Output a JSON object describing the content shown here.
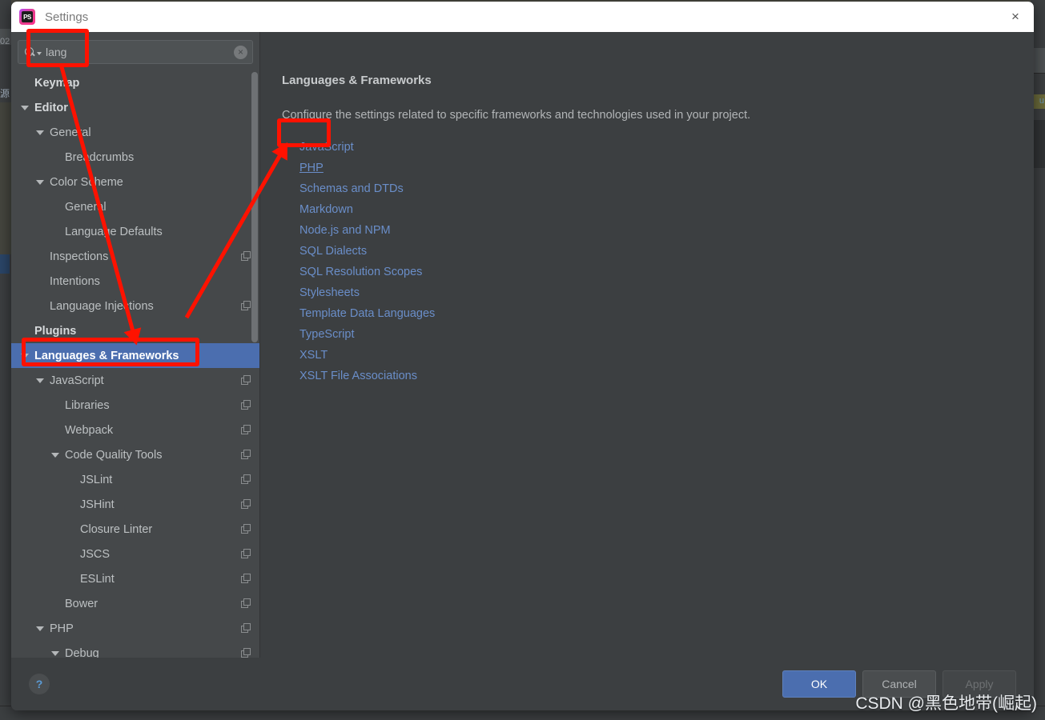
{
  "window": {
    "title": "Settings",
    "app_icon": "phpstorm-logo-icon",
    "close_icon": "×"
  },
  "search": {
    "value": "lang",
    "placeholder": "",
    "search_icon": "search-icon",
    "dropdown_icon": "chevron-down-icon",
    "clear_icon": "×"
  },
  "sidebar": {
    "items": [
      {
        "label": "Keymap",
        "indent": 0,
        "bold": true,
        "twisty": "none",
        "selected": false,
        "scope_icon": false
      },
      {
        "label": "Editor",
        "indent": 0,
        "bold": true,
        "twisty": "open",
        "selected": false,
        "scope_icon": false
      },
      {
        "label": "General",
        "indent": 1,
        "bold": false,
        "twisty": "open",
        "selected": false,
        "scope_icon": false
      },
      {
        "label": "Breadcrumbs",
        "indent": 2,
        "bold": false,
        "twisty": "none",
        "selected": false,
        "scope_icon": false
      },
      {
        "label": "Color Scheme",
        "indent": 1,
        "bold": false,
        "twisty": "open",
        "selected": false,
        "scope_icon": false
      },
      {
        "label": "General",
        "indent": 2,
        "bold": false,
        "twisty": "none",
        "selected": false,
        "scope_icon": false
      },
      {
        "label": "Language Defaults",
        "indent": 2,
        "bold": false,
        "twisty": "none",
        "selected": false,
        "scope_icon": false
      },
      {
        "label": "Inspections",
        "indent": 1,
        "bold": false,
        "twisty": "none",
        "selected": false,
        "scope_icon": true
      },
      {
        "label": "Intentions",
        "indent": 1,
        "bold": false,
        "twisty": "none",
        "selected": false,
        "scope_icon": false
      },
      {
        "label": "Language Injections",
        "indent": 1,
        "bold": false,
        "twisty": "none",
        "selected": false,
        "scope_icon": true
      },
      {
        "label": "Plugins",
        "indent": 0,
        "bold": true,
        "twisty": "none",
        "selected": false,
        "scope_icon": false
      },
      {
        "label": "Languages & Frameworks",
        "indent": 0,
        "bold": true,
        "twisty": "open",
        "selected": true,
        "scope_icon": false
      },
      {
        "label": "JavaScript",
        "indent": 1,
        "bold": false,
        "twisty": "open",
        "selected": false,
        "scope_icon": true
      },
      {
        "label": "Libraries",
        "indent": 2,
        "bold": false,
        "twisty": "none",
        "selected": false,
        "scope_icon": true
      },
      {
        "label": "Webpack",
        "indent": 2,
        "bold": false,
        "twisty": "none",
        "selected": false,
        "scope_icon": true
      },
      {
        "label": "Code Quality Tools",
        "indent": 2,
        "bold": false,
        "twisty": "open",
        "selected": false,
        "scope_icon": true
      },
      {
        "label": "JSLint",
        "indent": 3,
        "bold": false,
        "twisty": "none",
        "selected": false,
        "scope_icon": true
      },
      {
        "label": "JSHint",
        "indent": 3,
        "bold": false,
        "twisty": "none",
        "selected": false,
        "scope_icon": true
      },
      {
        "label": "Closure Linter",
        "indent": 3,
        "bold": false,
        "twisty": "none",
        "selected": false,
        "scope_icon": true
      },
      {
        "label": "JSCS",
        "indent": 3,
        "bold": false,
        "twisty": "none",
        "selected": false,
        "scope_icon": true
      },
      {
        "label": "ESLint",
        "indent": 3,
        "bold": false,
        "twisty": "none",
        "selected": false,
        "scope_icon": true
      },
      {
        "label": "Bower",
        "indent": 2,
        "bold": false,
        "twisty": "none",
        "selected": false,
        "scope_icon": true
      },
      {
        "label": "PHP",
        "indent": 1,
        "bold": false,
        "twisty": "open",
        "selected": false,
        "scope_icon": true
      },
      {
        "label": "Debug",
        "indent": 2,
        "bold": false,
        "twisty": "open",
        "selected": false,
        "scope_icon": true
      }
    ]
  },
  "main": {
    "heading": "Languages & Frameworks",
    "description": "Configure the settings related to specific frameworks and technologies used in your project.",
    "links": [
      {
        "label": "JavaScript",
        "hovered": false
      },
      {
        "label": "PHP",
        "hovered": true
      },
      {
        "label": "Schemas and DTDs",
        "hovered": false
      },
      {
        "label": "Markdown",
        "hovered": false
      },
      {
        "label": "Node.js and NPM",
        "hovered": false
      },
      {
        "label": "SQL Dialects",
        "hovered": false
      },
      {
        "label": "SQL Resolution Scopes",
        "hovered": false
      },
      {
        "label": "Stylesheets",
        "hovered": false
      },
      {
        "label": "Template Data Languages",
        "hovered": false
      },
      {
        "label": "TypeScript",
        "hovered": false
      },
      {
        "label": "XSLT",
        "hovered": false
      },
      {
        "label": "XSLT File Associations",
        "hovered": false
      }
    ]
  },
  "footer": {
    "help_icon": "?",
    "ok_label": "OK",
    "cancel_label": "Cancel",
    "apply_label": "Apply"
  },
  "annotations": {
    "highlight_color": "#ff1200",
    "boxes": [
      "search-field",
      "sidebar-languages-frameworks",
      "link-php"
    ],
    "arrows": [
      "search-to-sidebar",
      "lowerleft-to-php-link"
    ]
  },
  "watermark": {
    "text": "CSDN @黑色地带(崛起)"
  },
  "backdrop": {
    "gutter_text": "02",
    "side_text": "源",
    "code_hint": "u"
  },
  "colors": {
    "accent_blue": "#4b6eaf",
    "link_blue": "#6a8ec9",
    "annotation_red": "#ff1200",
    "panel_bg": "#3c3f41",
    "sidebar_bg": "#45484a"
  }
}
